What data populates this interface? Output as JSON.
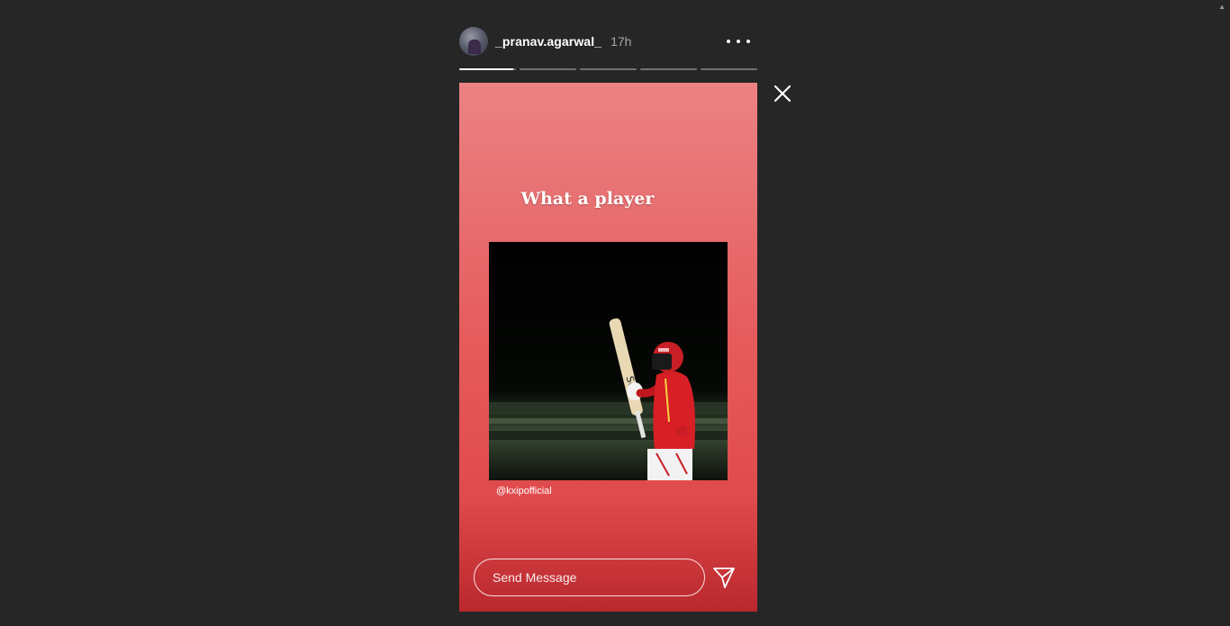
{
  "story": {
    "username": "_pranav.agarwal_",
    "time": "17h",
    "progress_segments": [
      0.95,
      0,
      0,
      0,
      0
    ],
    "caption": "What a player",
    "mention": "@kxipofficial",
    "photo_alt": "",
    "colors": {
      "gradient_top": "#ec8283",
      "gradient_bottom": "#b9282d",
      "jersey": "#d81f26"
    }
  },
  "reply": {
    "placeholder": "Send Message"
  },
  "icons": {
    "more": "more-options-icon",
    "close": "close-icon",
    "send": "send-icon"
  }
}
